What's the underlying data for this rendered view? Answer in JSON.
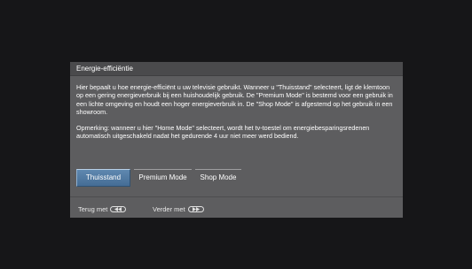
{
  "dialog": {
    "title": "Energie-efficiëntie",
    "paragraph1": "Hier bepaalt u hoe energie-efficiënt u uw televisie gebruikt. Wanneer u \"Thuisstand\" selecteert, ligt de klemtoon op een gering energieverbruik bij een huishoudelijk gebruik. De \"Premium Mode\" is bestemd voor een gebruik in een lichte omgeving en houdt een hoger energieverbruik in. De \"Shop Mode\" is afgestemd op het gebruik in een showroom.",
    "paragraph2": "Opmerking: wanneer u hier \"Home Mode\" selecteert, wordt het tv-toestel om energiebesparingsredenen automatisch uitgeschakeld nadat het gedurende 4 uur niet meer werd bediend.",
    "options": [
      {
        "label": "Thuisstand",
        "selected": true
      },
      {
        "label": "Premium Mode",
        "selected": false
      },
      {
        "label": "Shop Mode",
        "selected": false
      }
    ]
  },
  "footer": {
    "back_label": "Terug met",
    "back_icon": "rewind-button-icon",
    "next_label": "Verder met",
    "next_icon": "fast-forward-button-icon"
  },
  "colors": {
    "background": "#161618",
    "dialog": "#5d5d5f",
    "selected_option": "#4f7aa4"
  }
}
